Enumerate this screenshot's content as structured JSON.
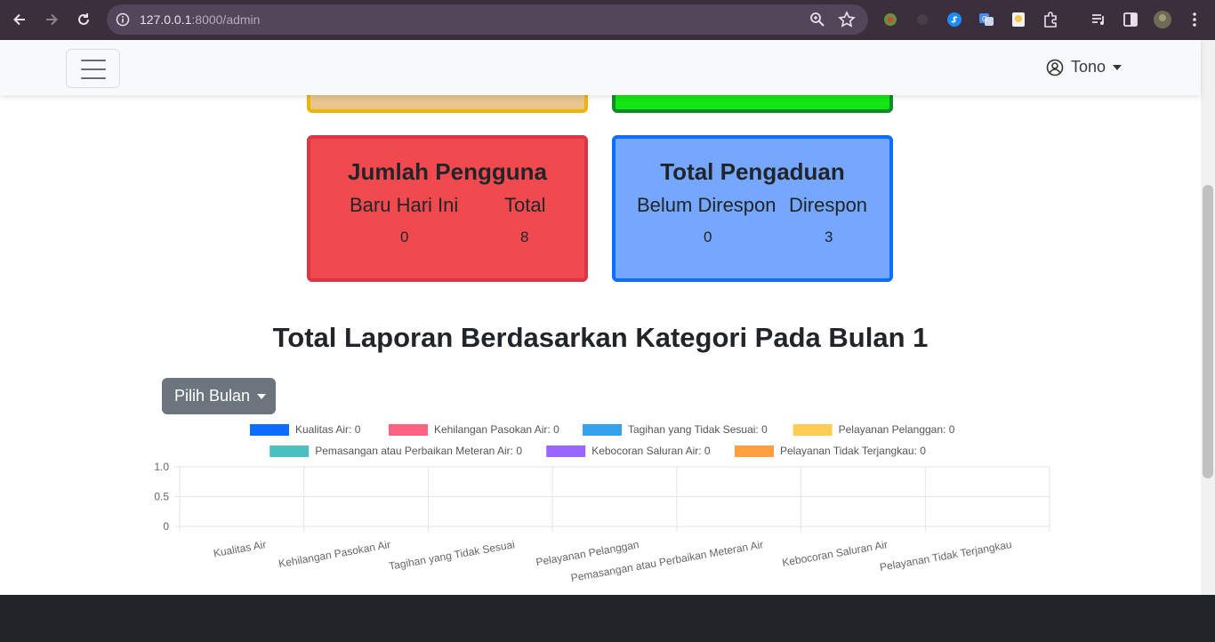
{
  "browser": {
    "url_host": "127.0.0.1",
    "url_path": ":8000/admin"
  },
  "navbar": {
    "user_name": "Tono"
  },
  "cards": {
    "users": {
      "title": "Jumlah Pengguna",
      "label_left": "Baru Hari Ini",
      "label_right": "Total",
      "value_left": "0",
      "value_right": "8"
    },
    "complaints": {
      "title": "Total Pengaduan",
      "label_left": "Belum Direspon",
      "label_right": "Direspon",
      "value_left": "0",
      "value_right": "3"
    }
  },
  "section_title": "Total Laporan Berdasarkan Kategori Pada Bulan 1",
  "month_button": "Pilih Bulan",
  "chart_data": {
    "type": "bar",
    "categories": [
      "Kualitas Air",
      "Kehilangan Pasokan Air",
      "Tagihan yang Tidak Sesuai",
      "Pelayanan Pelanggan",
      "Pemasangan atau Perbaikan Meteran Air",
      "Kebocoran Saluran Air",
      "Pelayanan Tidak Terjangkau"
    ],
    "series": [
      {
        "name": "Kualitas Air",
        "value": 0,
        "color": "#0d6efd"
      },
      {
        "name": "Kehilangan Pasokan Air",
        "value": 0,
        "color": "#ff6384"
      },
      {
        "name": "Tagihan yang Tidak Sesuai",
        "value": 0,
        "color": "#36a2eb"
      },
      {
        "name": "Pelayanan Pelanggan",
        "value": 0,
        "color": "#ffcd56"
      },
      {
        "name": "Pemasangan atau Perbaikan Meteran Air",
        "value": 0,
        "color": "#4bc0c0"
      },
      {
        "name": "Kebocoran Saluran Air",
        "value": 0,
        "color": "#9966ff"
      },
      {
        "name": "Pelayanan Tidak Terjangkau",
        "value": 0,
        "color": "#ff9f40"
      }
    ],
    "y_ticks": [
      "1.0",
      "0.5",
      "0"
    ],
    "ylim": [
      0,
      1
    ],
    "legend_placement": "top",
    "grid": true
  },
  "colors": {
    "card_red": "#f04a4f",
    "card_blue": "#74a7fd",
    "footer": "#212529"
  }
}
